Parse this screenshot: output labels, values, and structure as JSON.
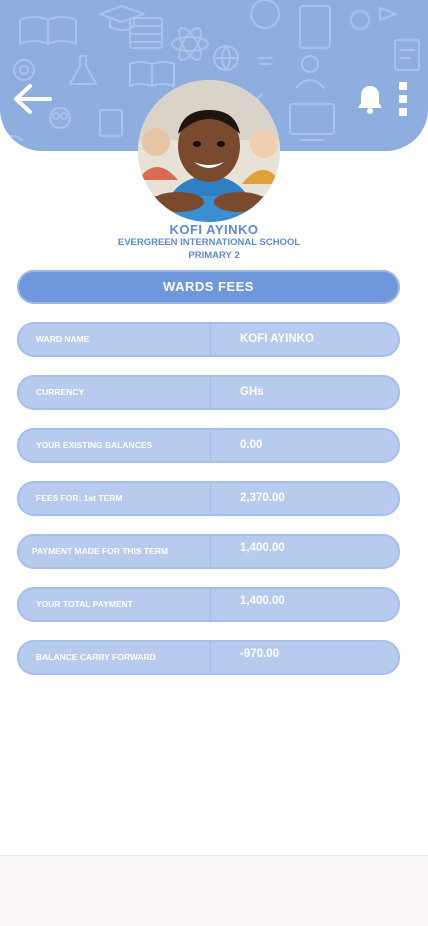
{
  "student": {
    "name": "KOFI AYINKO",
    "school": "EVERGREEN INTERNATIONAL SCHOOL",
    "class": "PRIMARY 2"
  },
  "section_title": "WARDS FEES",
  "fees": [
    {
      "label": "WARD NAME",
      "value": "KOFI AYINKO"
    },
    {
      "label": "CURRENCY",
      "value": "GHs"
    },
    {
      "label": "YOUR EXISTING BALANCES",
      "value": "0.00"
    },
    {
      "label": "FEES FOR: 1st TERM",
      "value": "2,370.00"
    },
    {
      "label": "PAYMENT MADE FOR THIS TERM",
      "value": "1,400.00"
    },
    {
      "label": "YOUR TOTAL PAYMENT",
      "value": "1,400.00"
    },
    {
      "label": "BALANCE CARRY FORWARD",
      "value": "-970.00"
    }
  ],
  "icons": {
    "back": "arrow-left-icon",
    "notifications": "bell-icon",
    "menu": "more-vertical-icon"
  },
  "colors": {
    "header": "#8eaedf",
    "accent": "#6f97db",
    "row": "#b7cbee",
    "text_accent": "#5f8ad3"
  }
}
